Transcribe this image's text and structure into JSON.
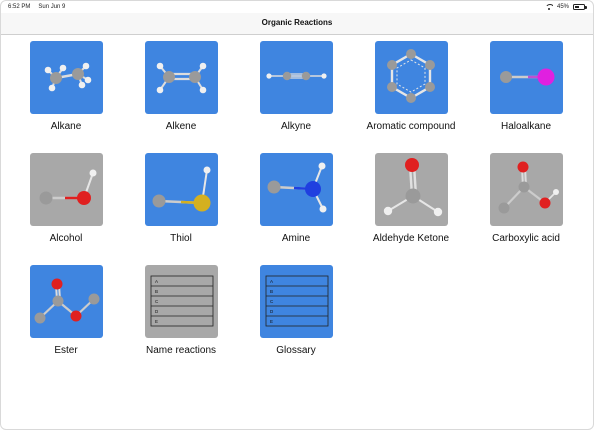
{
  "status": {
    "time": "6:52 PM",
    "date": "Sun Jun 9",
    "battery": "45%",
    "battery_level": 0.45
  },
  "header": {
    "title": "Organic Reactions"
  },
  "tiles": [
    {
      "label": "Alkane",
      "icon": "alkane-molecule-icon",
      "bg": "#3f85e0"
    },
    {
      "label": "Alkene",
      "icon": "alkene-molecule-icon",
      "bg": "#3f85e0"
    },
    {
      "label": "Alkyne",
      "icon": "alkyne-molecule-icon",
      "bg": "#3f85e0"
    },
    {
      "label": "Aromatic compound",
      "icon": "benzene-ring-icon",
      "bg": "#3f85e0"
    },
    {
      "label": "Haloalkane",
      "icon": "haloalkane-molecule-icon",
      "bg": "#3f85e0"
    },
    {
      "label": "Alcohol",
      "icon": "alcohol-molecule-icon",
      "bg": "#a8a8a8"
    },
    {
      "label": "Thiol",
      "icon": "thiol-molecule-icon",
      "bg": "#3f85e0"
    },
    {
      "label": "Amine",
      "icon": "amine-molecule-icon",
      "bg": "#3f85e0"
    },
    {
      "label": "Aldehyde Ketone",
      "icon": "carbonyl-molecule-icon",
      "bg": "#a8a8a8"
    },
    {
      "label": "Carboxylic acid",
      "icon": "carboxylic-acid-molecule-icon",
      "bg": "#a8a8a8"
    },
    {
      "label": "Ester",
      "icon": "ester-molecule-icon",
      "bg": "#3f85e0"
    },
    {
      "label": "Name reactions",
      "icon": "list-table-icon",
      "bg": "#a8a8a8"
    },
    {
      "label": "Glossary",
      "icon": "glossary-table-icon",
      "bg": "#3f85e0"
    }
  ],
  "name_reactions_rows": [
    "A",
    "B",
    "C",
    "D",
    "E"
  ],
  "glossary_rows": [
    "A",
    "B",
    "C",
    "D",
    "E"
  ],
  "colors": {
    "blue_tile": "#3f85e0",
    "gray_tile": "#a8a8a8",
    "carbon": "#9a9a9a",
    "hydrogen": "#f0f0f0",
    "oxygen": "#e02020",
    "halogen": "#e020e0",
    "sulfur": "#d4b020",
    "nitrogen": "#1f3fe0"
  }
}
